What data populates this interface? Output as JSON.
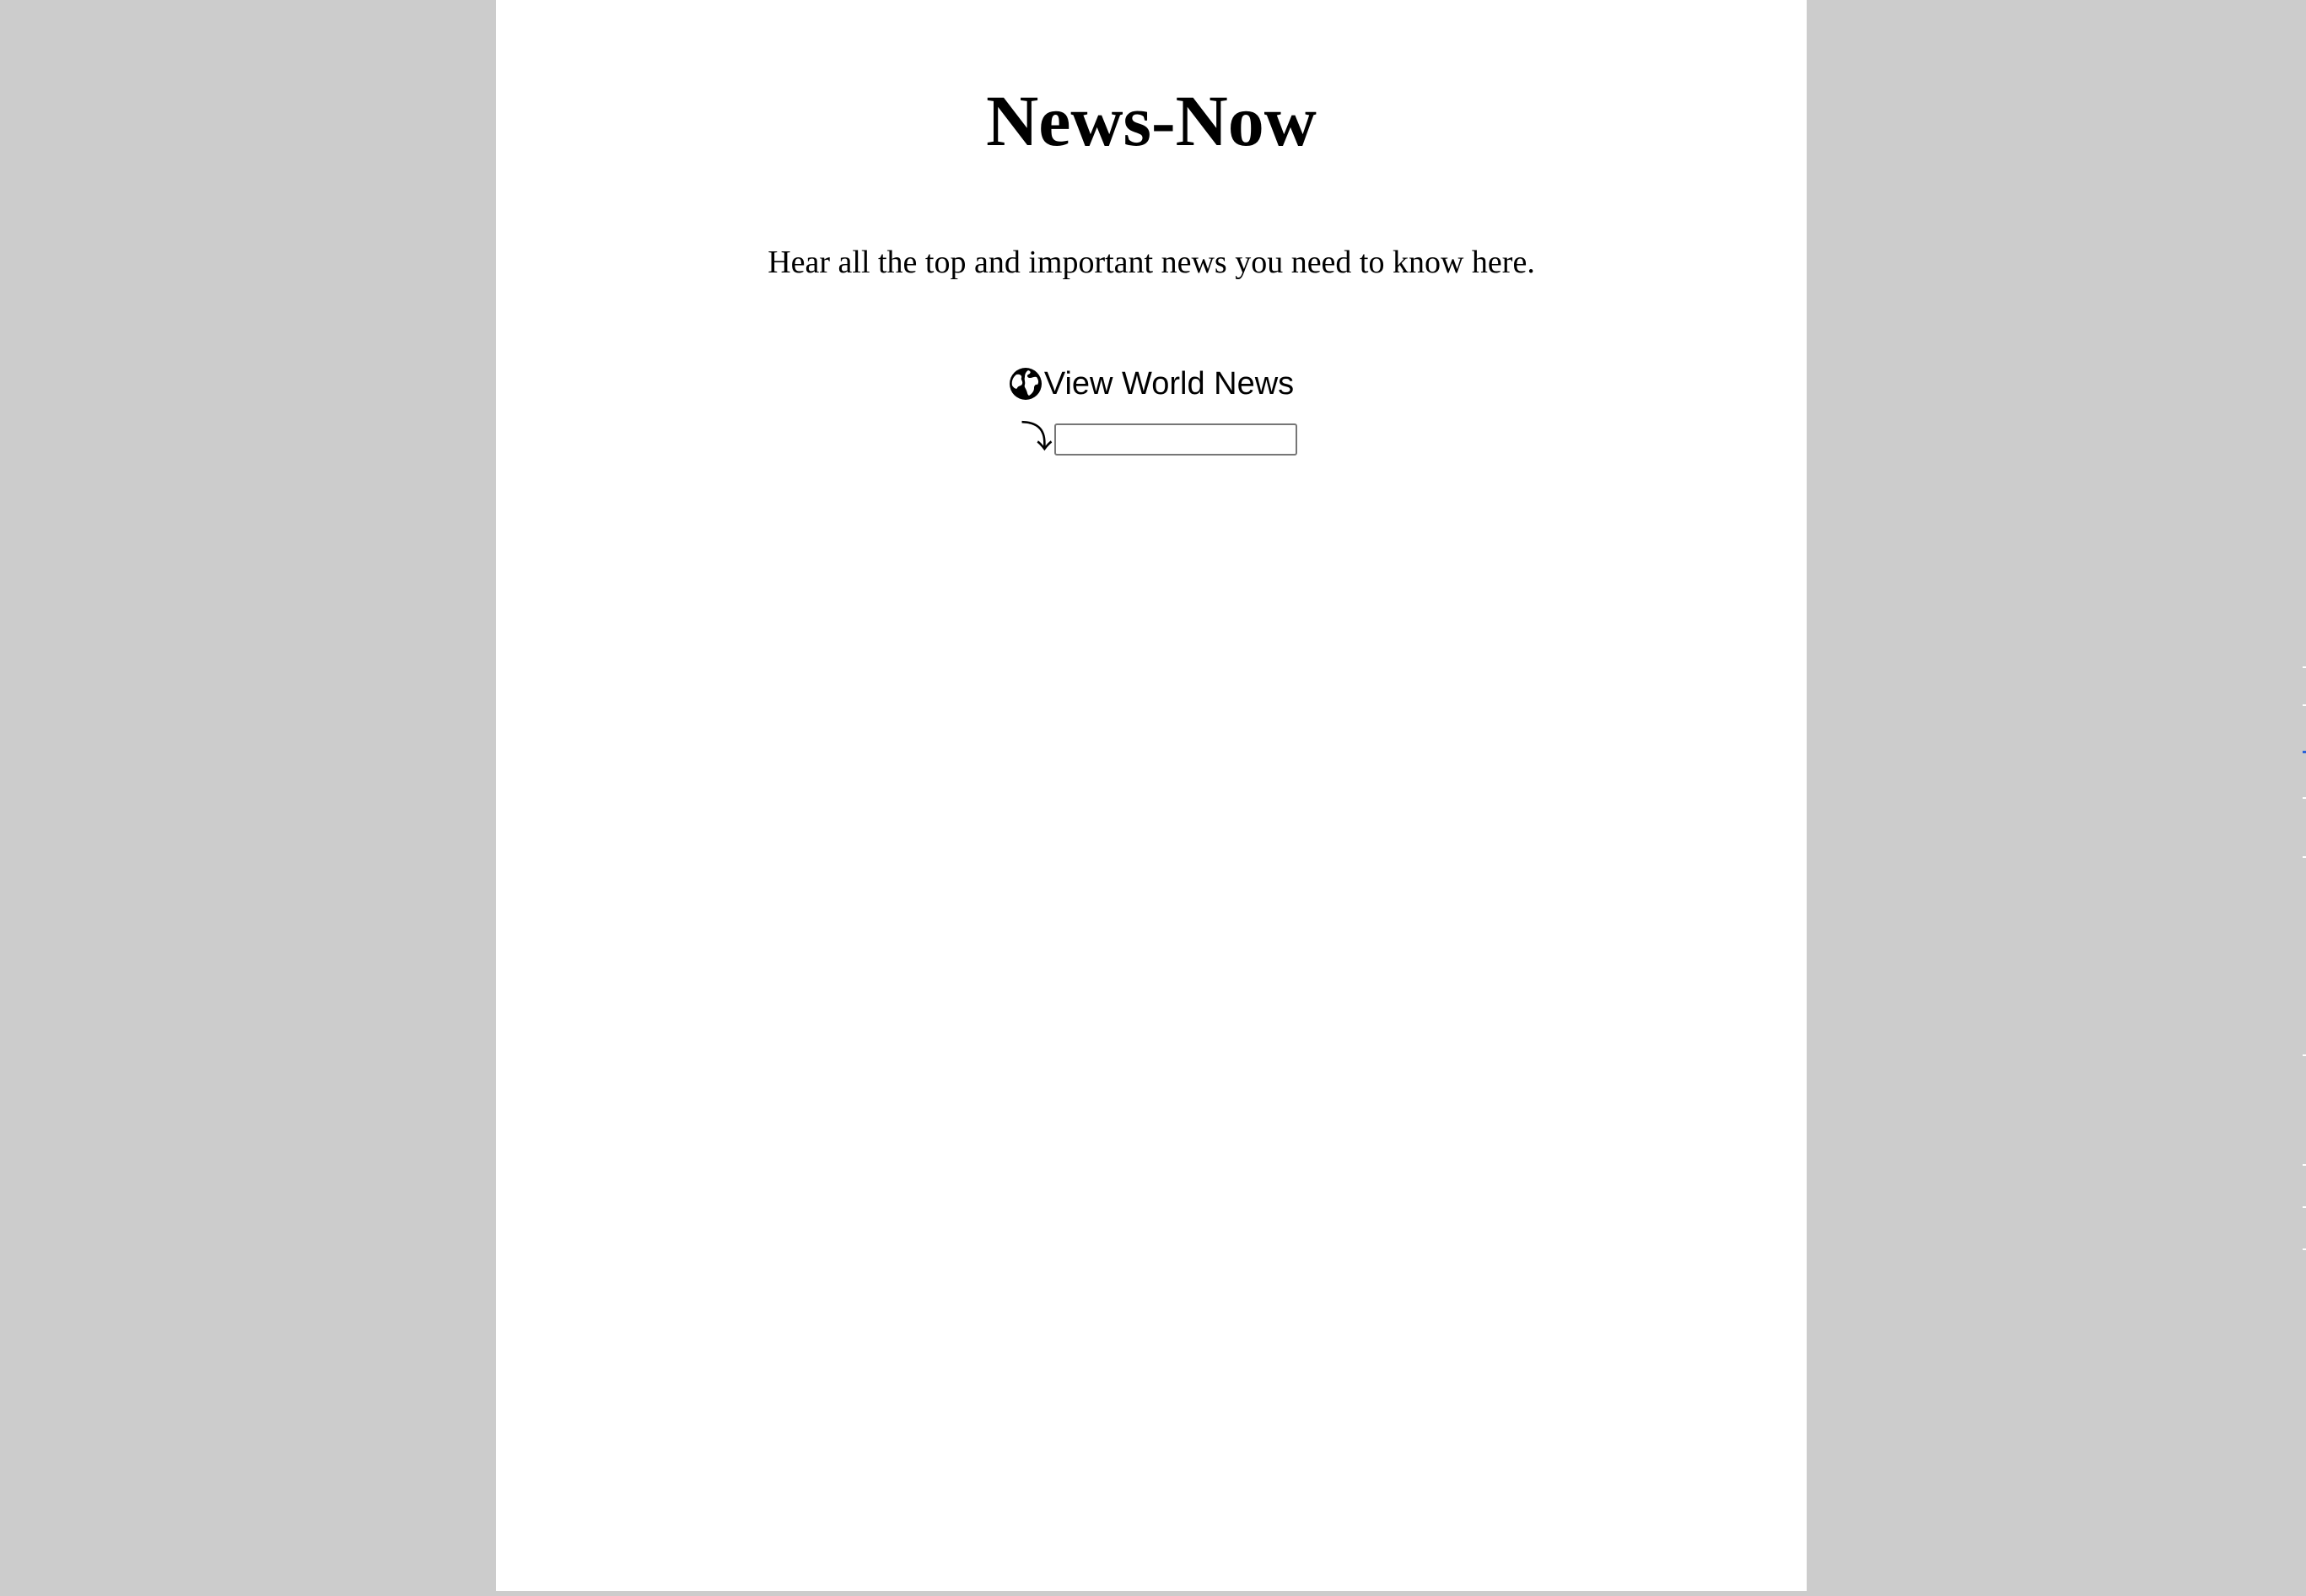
{
  "header": {
    "title": "News-Now"
  },
  "intro": {
    "tagline": "Hear all the top and important news you need to know here."
  },
  "nav": {
    "world_news_label": "View World News",
    "world_news_icon": "globe-icon"
  },
  "input": {
    "icon": "arrow-down-right-icon",
    "icon_glyph": "⤵",
    "value": "",
    "placeholder": ""
  },
  "colors": {
    "page_background": "#ffffff",
    "outer_background": "#cccccc",
    "text": "#000000"
  }
}
